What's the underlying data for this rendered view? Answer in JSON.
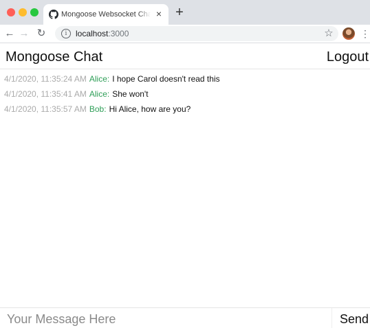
{
  "browser": {
    "tab_title": "Mongoose Websocket Chat with",
    "tab_close": "×",
    "new_tab": "+",
    "url_host": "localhost",
    "url_port": ":3000"
  },
  "icons": {
    "back": "back-arrow-icon",
    "forward": "forward-arrow-icon",
    "reload": "reload-icon",
    "info": "info-icon",
    "star": "star-icon",
    "menu": "more-vertical-icon",
    "tab": "github-icon"
  },
  "colors": {
    "username": "#2e9e57",
    "timestamp": "#aaaaaa",
    "text": "#111111"
  },
  "app": {
    "title": "Mongoose Chat",
    "logout_label": "Logout",
    "message_placeholder": "Your Message Here",
    "send_label": "Send"
  },
  "messages": [
    {
      "time": "4/1/2020, 11:35:24 AM",
      "user": "Alice:",
      "text": "I hope Carol doesn't read this"
    },
    {
      "time": "4/1/2020, 11:35:41 AM",
      "user": "Alice:",
      "text": "She won't"
    },
    {
      "time": "4/1/2020, 11:35:57 AM",
      "user": "Bob:",
      "text": "Hi Alice, how are you?"
    }
  ]
}
